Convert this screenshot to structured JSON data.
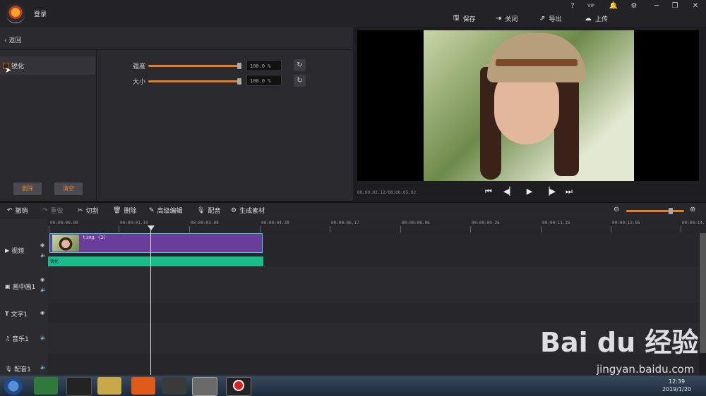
{
  "header": {
    "login": "登录",
    "window_controls": [
      "?",
      "VIP",
      "🔔",
      "⚙",
      "─",
      "❐",
      "✕"
    ],
    "save": "保存",
    "close": "关闭",
    "export": "导出",
    "upload": "上传"
  },
  "effects": {
    "back": "返回",
    "item": "锐化",
    "strength_label": "强度",
    "strength_value": "100.0 %",
    "strength_level": 100,
    "size_label": "大小",
    "size_value": "100.0 %",
    "size_level": 100,
    "delete": "删除",
    "clear": "清空"
  },
  "preview": {
    "time": "00:00:02.12/00:00:05.02"
  },
  "toolbar": {
    "undo": "撤销",
    "redo": "重做",
    "cut": "切割",
    "delete": "删除",
    "advanced_edit": "高级编辑",
    "dub": "配音",
    "generate": "生成素材"
  },
  "ruler": [
    "00:00:00.00",
    "00:00:01.19",
    "00:00:03.08",
    "00:00:04.28",
    "00:00:06.17",
    "00:00:08.06",
    "00:00:09.26",
    "00:00:11.15",
    "00:00:13.05",
    "00:00:14."
  ],
  "tracks": {
    "video": "视频",
    "pip": "画中画1",
    "text": "文字1",
    "music": "音乐1",
    "dub": "配音1",
    "clip_name": "timg (3)",
    "fx_name": "锐化"
  },
  "taskbar": {
    "time": "12:39",
    "date": "2019/1/20"
  },
  "watermark": {
    "brand": "Bai du 经验",
    "url": "jingyan.baidu.com"
  }
}
